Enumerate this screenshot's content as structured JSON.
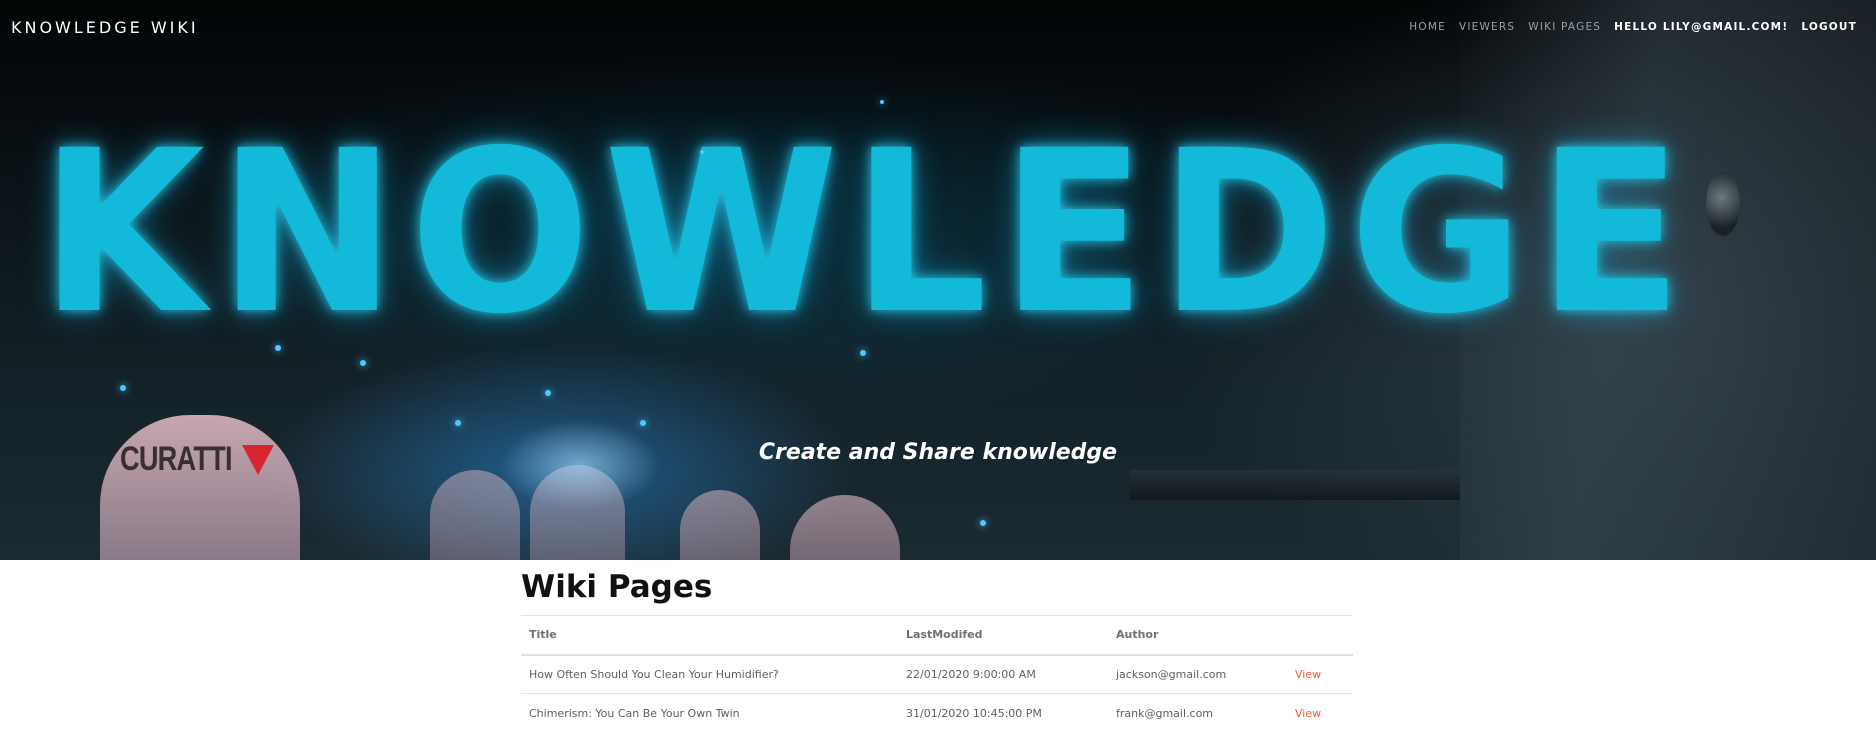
{
  "navbar": {
    "brand": "KNOWLEDGE WIKI",
    "links": [
      "HOME",
      "VIEWERS",
      "WIKI PAGES"
    ],
    "user_greeting": "HELLO LILY@GMAIL.COM!",
    "logout": "LOGOUT"
  },
  "hero": {
    "big_word": "KNOWLEDGE",
    "logo_text": "CURATTI",
    "tagline": "Create and Share knowledge"
  },
  "main": {
    "title": "Wiki Pages",
    "table": {
      "headers": [
        "Title",
        "LastModifed",
        "Author",
        ""
      ],
      "rows": [
        {
          "title": "How Often Should You Clean Your Humidifier?",
          "modified": "22/01/2020 9:00:00 AM",
          "author": "jackson@gmail.com",
          "action": "View"
        },
        {
          "title": "Chimerism: You Can Be Your Own Twin",
          "modified": "31/01/2020 10:45:00 PM",
          "author": "frank@gmail.com",
          "action": "View"
        }
      ]
    }
  },
  "colors": {
    "accent_link": "#f05a28",
    "hero_glow": "#13b9d8",
    "logo_red": "#d8252f"
  }
}
